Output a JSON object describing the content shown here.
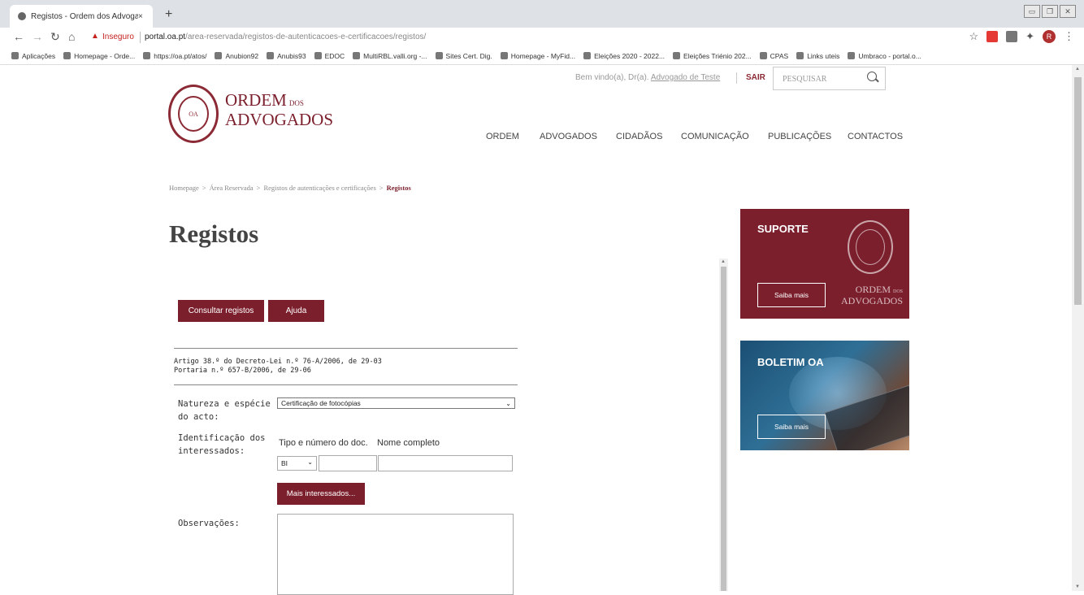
{
  "browser": {
    "tab_title": "Registos - Ordem dos Advogado:",
    "tab_close": "×",
    "new_tab": "+",
    "security_label": "Inseguro",
    "url_host": "portal.oa.pt",
    "url_path": "/area-reservada/registos-de-autenticacoes-e-certificacoes/registos/",
    "bookmarks": [
      "Aplicações",
      "Homepage - Orde...",
      "https://oa.pt/atos/",
      "Anubion92",
      "Anubis93",
      "EDOC",
      "MultiRBL.valli.org -...",
      "Sites Cert. Dig.",
      "Homepage - MyFid...",
      "Eleições 2020 - 2022...",
      "Eleições Triénio 202...",
      "CPAS",
      "Links uteis",
      "Umbraco - portal.o..."
    ]
  },
  "header": {
    "brand_line1": "ORDEM",
    "brand_small": "DOS",
    "brand_line2": "ADVOGADOS",
    "seal_text": "OA",
    "welcome": "Bem vindo(a), Dr(a).",
    "welcome_user": "Advogado de Teste",
    "logout": "SAIR",
    "search_placeholder": "PESQUISAR",
    "nav": [
      "ORDEM",
      "ADVOGADOS",
      "CIDADÃOS",
      "COMUNICAÇÃO",
      "PUBLICAÇÕES",
      "CONTACTOS"
    ]
  },
  "breadcrumb": {
    "items": [
      "Homepage",
      "Área Reservada",
      "Registos de autenticações e certificações"
    ],
    "sep": ">",
    "current": "Registos"
  },
  "page": {
    "title": "Registos",
    "btn_consultar": "Consultar registos",
    "btn_ajuda": "Ajuda",
    "legal_line1": "Artigo 38.º do Decreto-Lei n.º 76-A/2006, de 29-03",
    "legal_line2": "Portaria n.º 657-B/2006, de 29-06"
  },
  "form": {
    "natureza_label": "Natureza e espécie do acto:",
    "natureza_value": "Certificação de fotocópias",
    "ident_label": "Identificação dos interessados:",
    "col_tipo": "Tipo e número do doc.",
    "col_nome": "Nome completo",
    "doc_type_value": "BI",
    "btn_mais": "Mais interessados...",
    "obs_label": "Observações:"
  },
  "sidebar": {
    "suporte_title": "SUPORTE",
    "suporte_btn": "Saiba mais",
    "suporte_brand1": "ORDEM",
    "suporte_brand_small": "DOS",
    "suporte_brand2": "ADVOGADOS",
    "boletim_title": "BOLETIM OA",
    "boletim_btn": "Saiba mais"
  },
  "colors": {
    "brand": "#7b1f2c",
    "security_warning": "#c5221f"
  }
}
